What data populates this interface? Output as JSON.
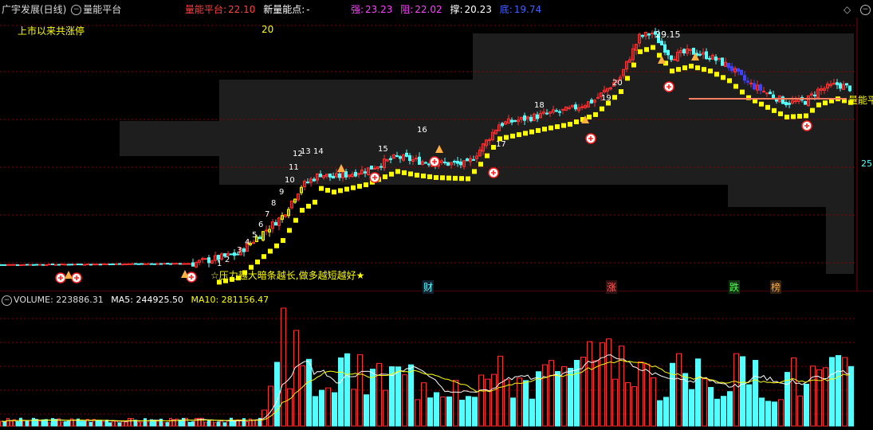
{
  "header": {
    "stock": "广宇发展(日线)",
    "indicator": "量能平台",
    "platform_label": "量能平台:",
    "platform_value": "22.10",
    "newpoint_label": "新量能点:",
    "newpoint_value": "-",
    "strong_label": "强:",
    "strong_value": "23.23",
    "resist_label": "阻:",
    "resist_value": "22.02",
    "support_label": "撑:",
    "support_value": "20.23",
    "bottom_label": "底:",
    "bottom_value": "19.74"
  },
  "colors": {
    "up": "#ff3030",
    "down": "#54ffff",
    "yellow": "#ffff00",
    "magenta": "#ff40ff",
    "blue": "#4040ff",
    "grid": "#8b0000",
    "zone": "#1e1e1e"
  },
  "main": {
    "limit_label": "上市以来共涨停",
    "limit_count": "20",
    "peak_label": "29.15",
    "slogan": "☆压力越大暗条越长,做多越短越好★",
    "platform_tag": "量能平",
    "right_tag": "25",
    "up_numbers": [
      "1",
      "2",
      "3",
      "4",
      "5",
      "6",
      "7",
      "8",
      "9",
      "10",
      "11",
      "12",
      "13",
      "14",
      "15",
      "16",
      "17",
      "18",
      "19",
      "20"
    ],
    "events": [
      "财",
      "涨",
      "跌",
      "榜"
    ]
  },
  "volume": {
    "label": "VOLUME: 223886.31",
    "ma5": "MA5: 244925.50",
    "ma10": "MA10: 281156.47"
  },
  "chart_data": {
    "type": "candlestick",
    "series": [
      {
        "name": "VOLUME",
        "values": []
      },
      {
        "name": "MA5",
        "values": []
      },
      {
        "name": "MA10",
        "values": []
      }
    ],
    "peak": 29.15,
    "levels": {
      "platform": 22.1,
      "strong": 23.23,
      "resist": 22.02,
      "support": 20.23,
      "bottom": 19.74
    }
  }
}
